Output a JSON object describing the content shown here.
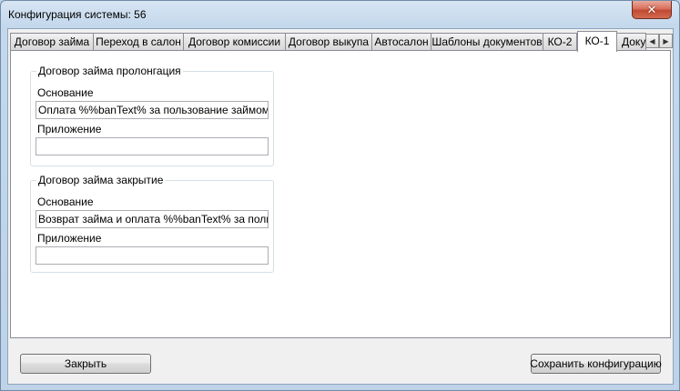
{
  "window": {
    "title": "Конфигурация системы: 56",
    "close_glyph": "✕"
  },
  "tabs": [
    {
      "label": "Договор займа"
    },
    {
      "label": "Переход в салон"
    },
    {
      "label": "Договор комиссии"
    },
    {
      "label": "Договор выкупа"
    },
    {
      "label": "Автосалон"
    },
    {
      "label": "Шаблоны документов"
    },
    {
      "label": "КО-2"
    },
    {
      "label": "КО-1"
    },
    {
      "label": "Доку"
    }
  ],
  "active_tab": "КО-1",
  "tab_scroll": {
    "left_glyph": "◀",
    "right_glyph": "▶"
  },
  "groups": [
    {
      "legend": "Договор займа пролонгация",
      "basis_label": "Основание",
      "basis_value": "Оплата %%banText% за пользование займом по ,",
      "attachment_label": "Приложение",
      "attachment_value": ""
    },
    {
      "legend": "Договор займа закрытие",
      "basis_label": "Основание",
      "basis_value": "Возврат займа и оплата %%banText% за пользов",
      "attachment_label": "Приложение",
      "attachment_value": ""
    }
  ],
  "buttons": {
    "close_label": "Закрыть",
    "save_label": "Сохранить конфигурацию"
  }
}
